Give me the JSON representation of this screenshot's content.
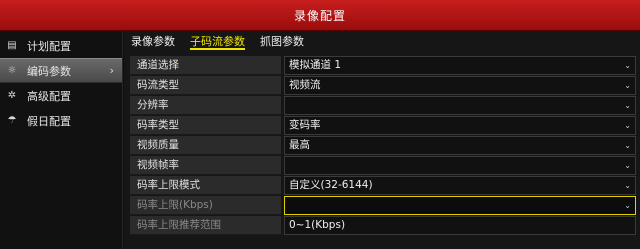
{
  "window": {
    "title": "录像配置"
  },
  "sidebar": {
    "items": [
      {
        "label": "计划配置",
        "icon": "calendar-icon",
        "active": false
      },
      {
        "label": "编码参数",
        "icon": "gear-icon",
        "active": true
      },
      {
        "label": "高级配置",
        "icon": "settings-icon",
        "active": false
      },
      {
        "label": "假日配置",
        "icon": "umbrella-icon",
        "active": false
      }
    ],
    "arrow": "›"
  },
  "tabs": [
    {
      "label": "录像参数",
      "active": false
    },
    {
      "label": "子码流参数",
      "active": true
    },
    {
      "label": "抓图参数",
      "active": false
    }
  ],
  "form": {
    "rows": [
      {
        "label": "通道选择",
        "value": "模拟通道 1",
        "dropdown": true
      },
      {
        "label": "码流类型",
        "value": "视频流",
        "dropdown": true
      },
      {
        "label": "分辨率",
        "value": "",
        "dropdown": true
      },
      {
        "label": "码率类型",
        "value": "变码率",
        "dropdown": true
      },
      {
        "label": "视频质量",
        "value": "最高",
        "dropdown": true
      },
      {
        "label": "视频帧率",
        "value": "",
        "dropdown": true
      },
      {
        "label": "码率上限模式",
        "value": "自定义(32-6144)",
        "dropdown": true
      },
      {
        "label": "码率上限(Kbps)",
        "value": "",
        "dropdown": true,
        "dim": true,
        "highlight": true
      },
      {
        "label": "码率上限推荐范围",
        "value": "0~1(Kbps)",
        "dropdown": false,
        "dim": true
      }
    ]
  },
  "colors": {
    "title_bar": "#b31414",
    "active_tab": "#f2e600",
    "field_highlight": "#e0d000"
  }
}
